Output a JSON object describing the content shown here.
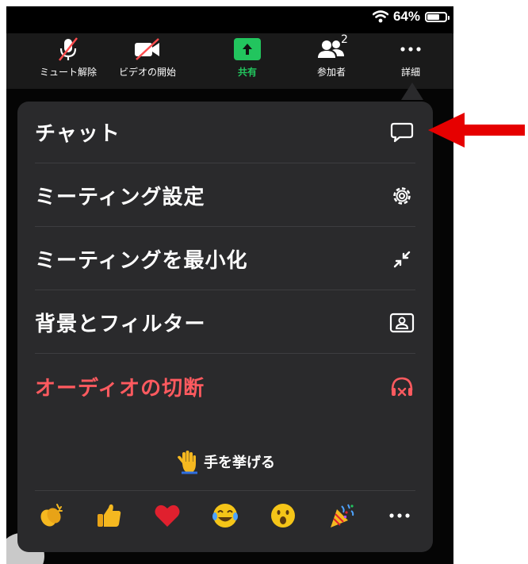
{
  "status": {
    "battery_text": "64%",
    "battery_level": 0.64
  },
  "toolbar": {
    "mute_label": "ミュート解除",
    "video_label": "ビデオの開始",
    "share_label": "共有",
    "participants_label": "参加者",
    "participants_count": "2",
    "more_label": "詳細"
  },
  "menu": {
    "items": [
      {
        "label": "チャット",
        "icon": "chat-bubble-icon"
      },
      {
        "label": "ミーティング設定",
        "icon": "gear-icon"
      },
      {
        "label": "ミーティングを最小化",
        "icon": "minimize-icon"
      },
      {
        "label": "背景とフィルター",
        "icon": "portrait-icon"
      },
      {
        "label": "オーディオの切断",
        "icon": "headphones-disconnect-icon"
      }
    ],
    "raise_hand_label": "手を挙げる",
    "reactions": [
      "clap",
      "thumbs-up",
      "heart",
      "joy",
      "open-mouth",
      "tada",
      "more"
    ]
  },
  "colors": {
    "share_green": "#22c55e",
    "danger_red": "#ff5a5f",
    "menu_bg": "#2a2a2c",
    "annotation_arrow": "#e60000"
  }
}
